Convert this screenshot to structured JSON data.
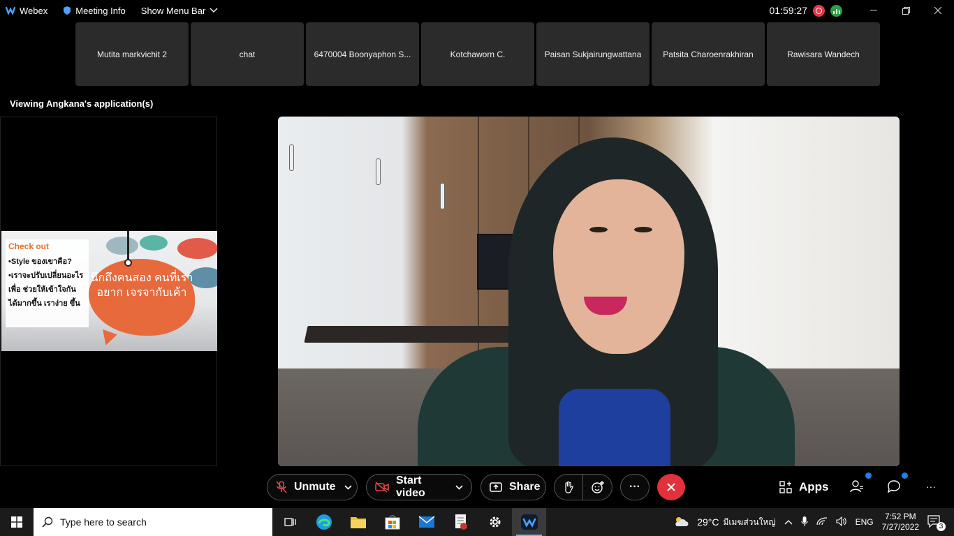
{
  "topbar": {
    "app_name": "Webex",
    "meeting_info": "Meeting Info",
    "show_menu_bar": "Show Menu Bar",
    "clock": "01:59:27"
  },
  "participants": [
    "Mutita markvichit 2",
    "chat",
    "6470004 Boonyaphon S...",
    "Kotchaworn C.",
    "Paisan Sukjairungwattana",
    "Patsita Charoenrakhiran",
    "Rawisara Wandech"
  ],
  "viewing_label": "Viewing Angkana's application(s)",
  "slide": {
    "title": "Check out",
    "bullets": [
      "•Style ของเขาคือ?",
      "•เราจะปรับเปลี่ยนอะไร เพื่อ ช่วยให้เข้าใจกัน ได้มากขึ้น เราง่าย ขึ้น"
    ],
    "bubble_text": "นึกถึงคนสอง คนที่เราอยาก เจรจากับเค้า"
  },
  "controls": {
    "unmute": "Unmute",
    "start_video": "Start video",
    "share": "Share",
    "apps": "Apps",
    "more": "···"
  },
  "taskbar": {
    "search_placeholder": "Type here to search",
    "weather": "29°C",
    "weather_desc": "มีเมฆส่วนใหญ่",
    "lang": "ENG",
    "time": "7:52 PM",
    "date": "7/27/2022",
    "notif_count": "3"
  },
  "colors": {
    "end_call": "#e0313c",
    "accent_blue": "#1d7fe8",
    "tile_bg": "#2b2b2b"
  }
}
